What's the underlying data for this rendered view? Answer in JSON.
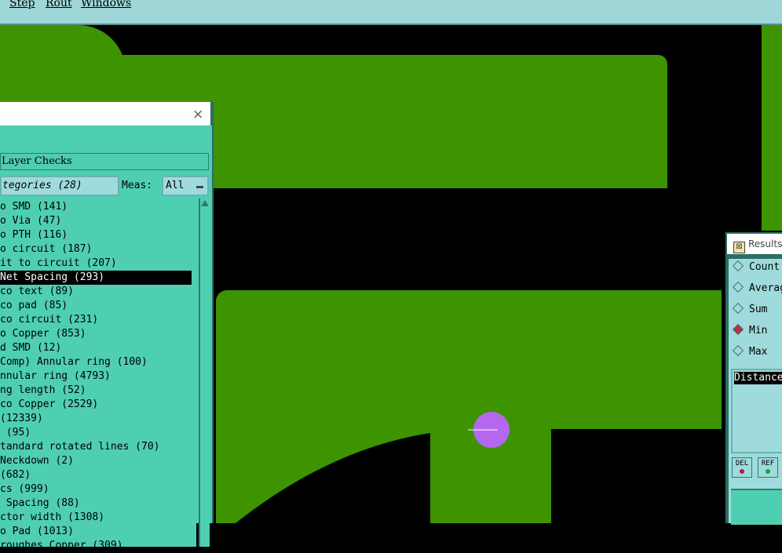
{
  "menubar": {
    "items": [
      "Step",
      "Rout",
      "Windows"
    ]
  },
  "checks_panel": {
    "close_symbol": "×",
    "layer_checks_label": "Layer Checks",
    "categories_label": "tegories (28)",
    "meas_label": "Meas:",
    "meas_value": "All",
    "selected_index": 5,
    "items": [
      "o SMD (141)",
      "o Via (47)",
      "o PTH (116)",
      "o circuit (187)",
      "it to circuit (207)",
      "Net Spacing (293)",
      "co text (89)",
      "co pad (85)",
      "co circuit (231)",
      "o Copper (853)",
      "d SMD (12)",
      "Comp) Annular ring (100)",
      "nnular ring (4793)",
      "ng length (52)",
      "co Copper (2529)",
      "(12339)",
      " (95)",
      "tandard rotated lines (70)",
      "Neckdown (2)",
      "(682)",
      "cs (999)",
      " Spacing (88)",
      "ctor width (1308)",
      "o Pad (1013)",
      "roughes Copper (309)"
    ]
  },
  "results_panel": {
    "title": "Results",
    "options": [
      "Count",
      "Average",
      "Sum",
      "Min",
      "Max"
    ],
    "selected_option": "Min",
    "list_header": "Distance",
    "buttons": [
      {
        "label": "DEL",
        "dot_color": "#c2183a"
      },
      {
        "label": "REF",
        "dot_color": "#1fa03a"
      }
    ]
  },
  "colors": {
    "copper": "#3d9300",
    "marker": "#b468f0",
    "panel": "#4fcfb2",
    "menubar": "#9fd7d9"
  }
}
